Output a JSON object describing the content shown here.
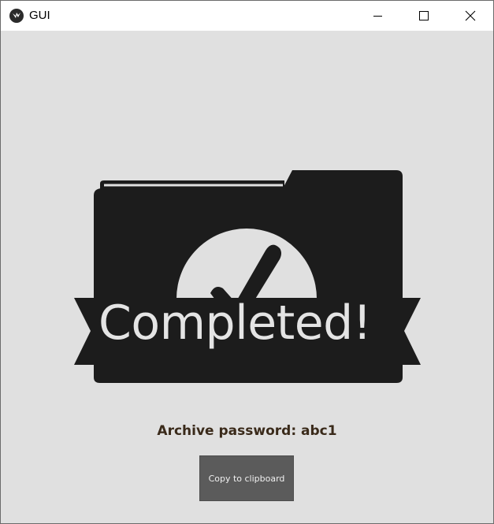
{
  "window": {
    "title": "GUI",
    "app_icon": "kivy-logo-icon",
    "controls": [
      "minimize-icon",
      "maximize-icon",
      "close-icon"
    ]
  },
  "main": {
    "badge_text": "Completed!",
    "badge_icon": "folder-checkmark-icon",
    "password_label": "Archive password: abc1",
    "copy_button_label": "Copy to clipboard"
  },
  "colors": {
    "background": "#e0e0e0",
    "badge": "#1c1c1c",
    "button": "#5b5b5b",
    "password_text": "#3a2a1a"
  }
}
